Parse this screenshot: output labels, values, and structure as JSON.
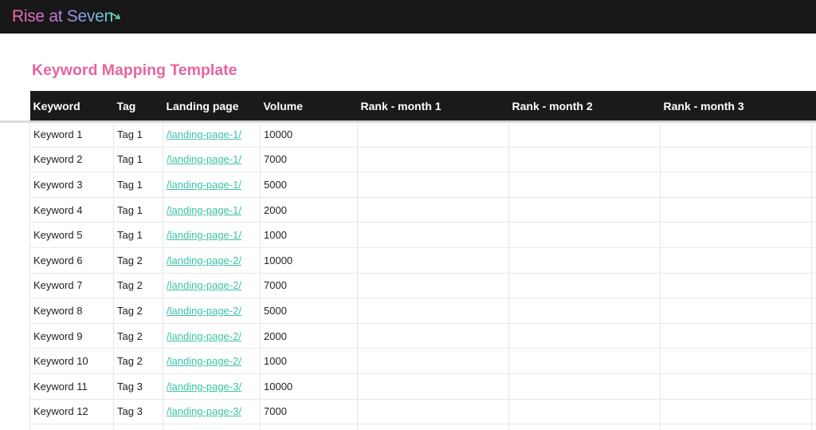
{
  "brand": {
    "logo_text": "Rise at Seven",
    "gradient": [
      "#f06aa6",
      "#c07ad8",
      "#7fa4e6",
      "#6fdbc6"
    ],
    "bar_color": "#171717"
  },
  "page": {
    "title": "Keyword Mapping Template",
    "title_color": "#e5659e"
  },
  "table": {
    "headers": {
      "keyword": "Keyword",
      "tag": "Tag",
      "landing_page": "Landing page",
      "volume": "Volume",
      "rank_m1": "Rank - month 1",
      "rank_m2": "Rank - month 2",
      "rank_m3": "Rank - month 3"
    },
    "link_color": "#3cc2a5",
    "rows": [
      {
        "keyword": "Keyword 1",
        "tag": "Tag 1",
        "landing_page": "/landing-page-1/",
        "volume": "10000"
      },
      {
        "keyword": "Keyword 2",
        "tag": "Tag 1",
        "landing_page": "/landing-page-1/",
        "volume": "7000"
      },
      {
        "keyword": "Keyword 3",
        "tag": "Tag 1",
        "landing_page": "/landing-page-1/",
        "volume": "5000"
      },
      {
        "keyword": "Keyword 4",
        "tag": "Tag 1",
        "landing_page": "/landing-page-1/",
        "volume": "2000"
      },
      {
        "keyword": "Keyword 5",
        "tag": "Tag 1",
        "landing_page": "/landing-page-1/",
        "volume": "1000"
      },
      {
        "keyword": "Keyword 6",
        "tag": "Tag 2",
        "landing_page": "/landing-page-2/",
        "volume": "10000"
      },
      {
        "keyword": "Keyword 7",
        "tag": "Tag 2",
        "landing_page": "/landing-page-2/",
        "volume": "7000"
      },
      {
        "keyword": "Keyword 8",
        "tag": "Tag 2",
        "landing_page": "/landing-page-2/",
        "volume": "5000"
      },
      {
        "keyword": "Keyword 9",
        "tag": "Tag 2",
        "landing_page": "/landing-page-2/",
        "volume": "2000"
      },
      {
        "keyword": "Keyword 10",
        "tag": "Tag 2",
        "landing_page": "/landing-page-2/",
        "volume": "1000"
      },
      {
        "keyword": "Keyword 11",
        "tag": "Tag 3",
        "landing_page": "/landing-page-3/",
        "volume": "10000"
      },
      {
        "keyword": "Keyword 12",
        "tag": "Tag 3",
        "landing_page": "/landing-page-3/",
        "volume": "7000"
      },
      {
        "keyword": "",
        "tag": "",
        "landing_page": "",
        "volume": ""
      }
    ]
  }
}
